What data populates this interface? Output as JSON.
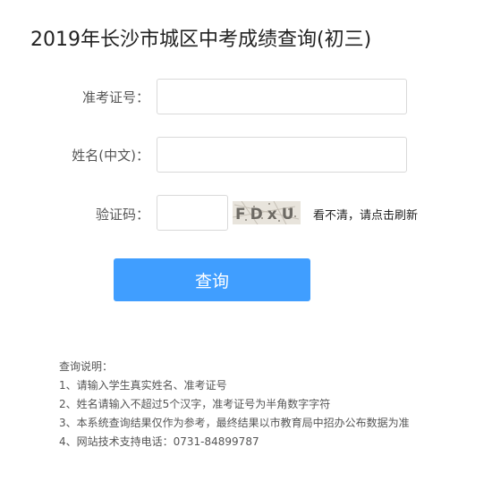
{
  "page": {
    "title": "2019年长沙市城区中考成绩查询(初三)"
  },
  "form": {
    "exam_id": {
      "label": "准考证号：",
      "value": "",
      "placeholder": ""
    },
    "name": {
      "label": "姓名(中文)：",
      "value": "",
      "placeholder": ""
    },
    "captcha": {
      "label": "验证码：",
      "value": "",
      "placeholder": "",
      "image_text": "FDxU",
      "refresh_hint": "看不清，请点击刷新"
    },
    "submit_label": "查询"
  },
  "notes": {
    "heading": "查询说明：",
    "items": [
      "1、请输入学生真实姓名、准考证号",
      "2、姓名请输入不超过5个汉字，准考证号为半角数字字符",
      "3、本系统查询结果仅作为参考，最终结果以市教育局中招办公布数据为准",
      "4、网站技术支持电话：0731-84899787"
    ]
  },
  "colors": {
    "button": "#409eff",
    "input_border": "#d9d9d9"
  }
}
